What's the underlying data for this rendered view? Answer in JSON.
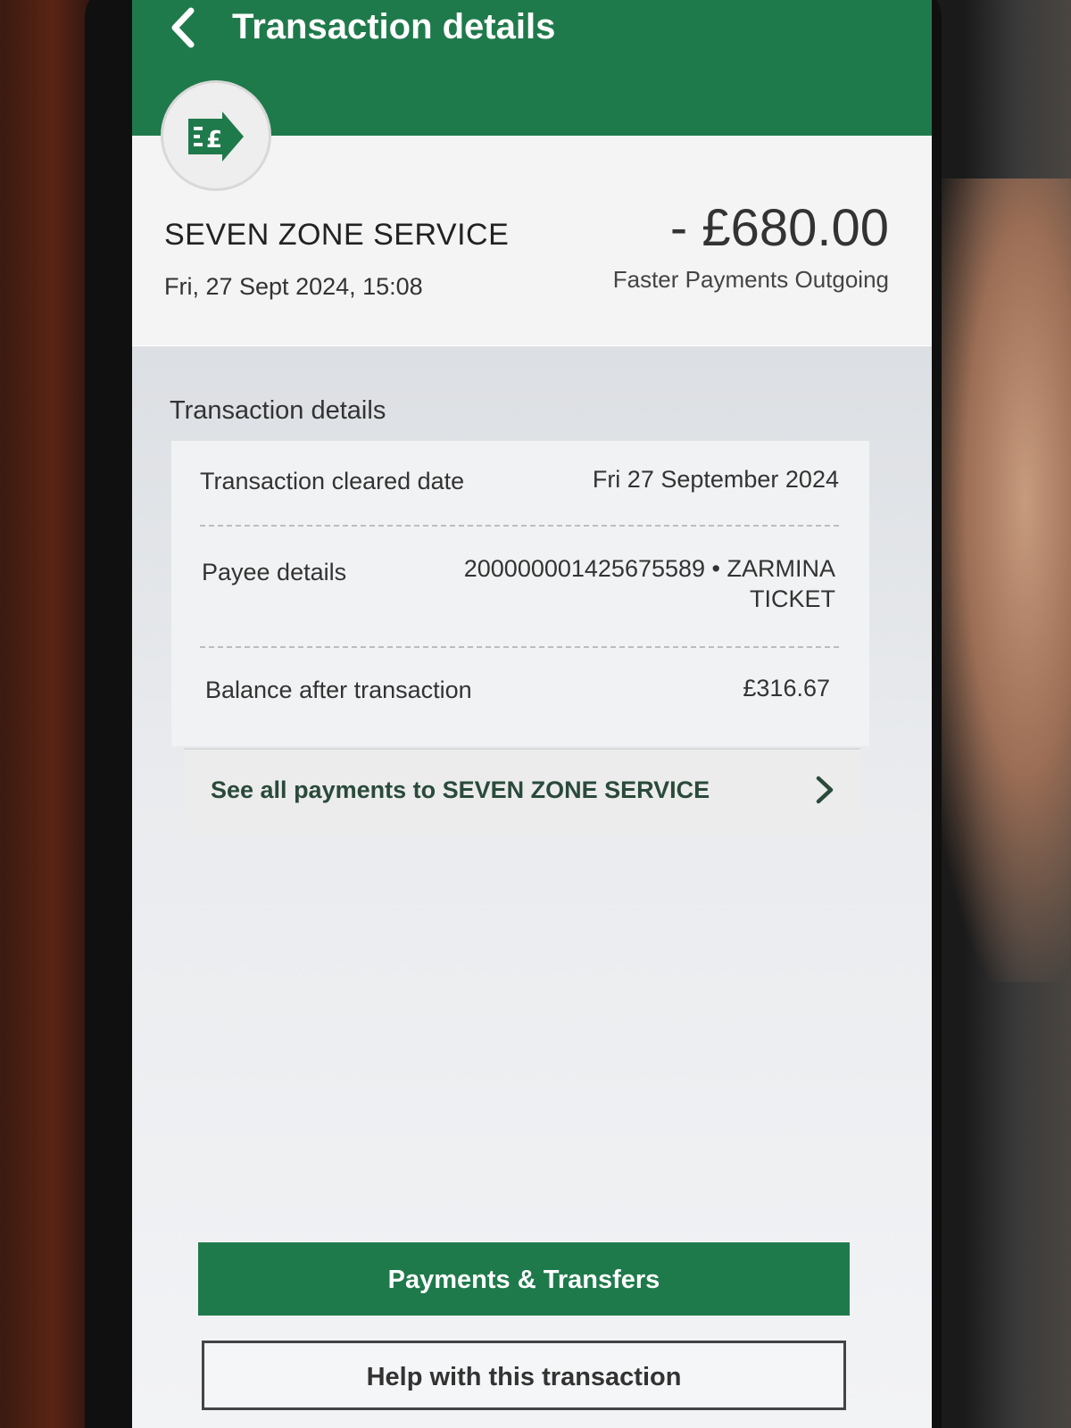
{
  "header": {
    "title": "Transaction details",
    "back_icon": "chevron-left-icon"
  },
  "summary": {
    "type_icon": "faster-payment-outgoing-icon",
    "payee_name": "SEVEN ZONE SERVICE",
    "datetime": "Fri, 27 Sept 2024, 15:08",
    "amount": "- £680.00",
    "payment_type": "Faster Payments Outgoing"
  },
  "details": {
    "heading": "Transaction details",
    "rows": [
      {
        "label": "Transaction cleared date",
        "value": "Fri 27 September 2024"
      },
      {
        "label": "Payee details",
        "value_line1": "200000001425675589 • ZARMINA",
        "value_line2": "TICKET"
      },
      {
        "label": "Balance after transaction",
        "value": "£316.67"
      }
    ],
    "see_all_label": "See all payments to SEVEN ZONE SERVICE"
  },
  "actions": {
    "primary_label": "Payments & Transfers",
    "secondary_label": "Help with this transaction"
  },
  "colors": {
    "brand_green": "#1f7a4b",
    "text_dark": "#333333"
  }
}
